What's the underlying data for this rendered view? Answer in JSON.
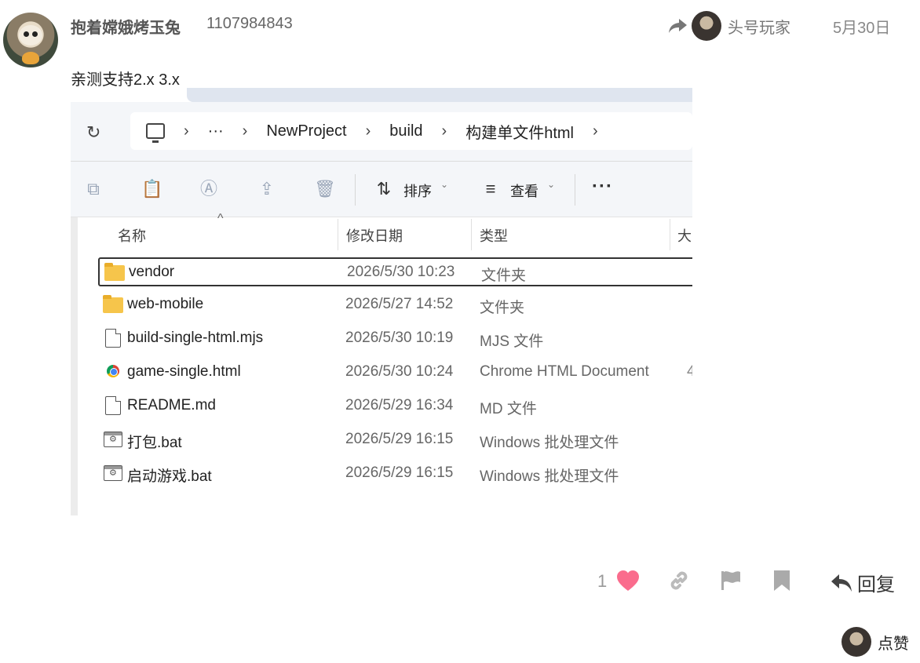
{
  "post": {
    "username": "抱着嫦娥烤玉兔",
    "user_id": "1107984843",
    "reply_to_name": "头号玩家",
    "date": "5月30日",
    "text": "亲测支持2.x 3.x"
  },
  "explorer": {
    "breadcrumb": [
      "···",
      "NewProject",
      "build",
      "构建单文件html"
    ],
    "toolbar": {
      "sort_label": "排序",
      "view_label": "查看",
      "more_label": "···"
    },
    "columns": {
      "name": "名称",
      "date": "修改日期",
      "type": "类型",
      "size": "大"
    },
    "files": [
      {
        "name": "vendor",
        "date": "2026/5/30 10:23",
        "type": "文件夹",
        "size": "",
        "icon": "folder-icon"
      },
      {
        "name": "web-mobile",
        "date": "2026/5/27 14:52",
        "type": "文件夹",
        "size": "",
        "icon": "folder-icon"
      },
      {
        "name": "build-single-html.mjs",
        "date": "2026/5/30 10:19",
        "type": "MJS 文件",
        "size": "",
        "icon": "file-icon"
      },
      {
        "name": "game-single.html",
        "date": "2026/5/30 10:24",
        "type": "Chrome HTML Document",
        "size": "4",
        "icon": "chrome-icon"
      },
      {
        "name": "README.md",
        "date": "2026/5/29 16:34",
        "type": "MD 文件",
        "size": "",
        "icon": "file-icon"
      },
      {
        "name": "打包.bat",
        "date": "2026/5/29 16:15",
        "type": "Windows 批处理文件",
        "size": "",
        "icon": "batch-file-icon"
      },
      {
        "name": "启动游戏.bat",
        "date": "2026/5/29 16:15",
        "type": "Windows 批处理文件",
        "size": "",
        "icon": "batch-file-icon"
      }
    ]
  },
  "actions": {
    "like_count": "1",
    "reply_label": "回复",
    "liked_by_label": "点赞",
    "like_color": "#fa6c8d"
  }
}
